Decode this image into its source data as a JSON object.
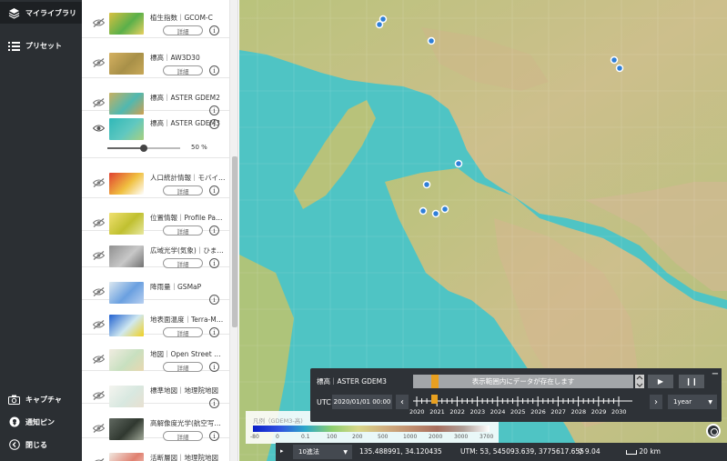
{
  "nav": {
    "library": {
      "label": "マイライブラリ",
      "icon": "layers-icon"
    },
    "preset": {
      "label": "プリセット",
      "icon": "list-icon"
    },
    "capture": {
      "label": "キャプチャ",
      "icon": "camera-icon"
    },
    "notify_pin": {
      "label": "通知ピン",
      "icon": "pin-icon"
    },
    "close": {
      "label": "閉じる",
      "icon": "chevron-left-icon"
    }
  },
  "layers": [
    {
      "name": "植生指数｜GCOM-C",
      "details": "詳細",
      "visible": false
    },
    {
      "name": "標高｜AW3D30",
      "details": "詳細",
      "visible": false
    },
    {
      "name": "標高｜ASTER GDEM2",
      "details": "",
      "visible": false
    },
    {
      "name": "標高｜ASTER GDEM3",
      "details": "",
      "visible": true,
      "opacity_label": "50 %",
      "opacity": 0.5
    },
    {
      "name": "人口統計情報｜モバイ…",
      "details": "詳細",
      "visible": false
    },
    {
      "name": "位置情報｜Profile Pa…",
      "details": "詳細",
      "visible": false
    },
    {
      "name": "広域光学(気象)｜ひま…",
      "details": "詳細",
      "visible": false
    },
    {
      "name": "降雨量｜GSMaP",
      "details": "",
      "visible": false
    },
    {
      "name": "地表面温度｜Terra-M…",
      "details": "詳細",
      "visible": false
    },
    {
      "name": "地図｜Open Street …",
      "details": "詳細",
      "visible": false
    },
    {
      "name": "標準地図｜地理院地図",
      "details": "",
      "visible": false
    },
    {
      "name": "高解像度光学(航空写…",
      "details": "詳細",
      "visible": false
    },
    {
      "name": "活断層図｜地理院地図",
      "details": "",
      "visible": false
    }
  ],
  "time_panel": {
    "layer": "標高｜ASTER GDEM3",
    "message": "表示範囲内にデータが存在します",
    "utc_label": "UTC",
    "date": "2020/01/01 00:00",
    "years": [
      "2020",
      "2021",
      "2022",
      "2023",
      "2024",
      "2025",
      "2026",
      "2027",
      "2028",
      "2029",
      "2030"
    ],
    "step": "1year",
    "play": "▶",
    "pause": "❙❙",
    "minimize": "−"
  },
  "legend": {
    "title": "凡例（GDEM3-高)",
    "labels": [
      "-80",
      "0",
      "0.1",
      "100",
      "200",
      "500",
      "1000",
      "2000",
      "3000",
      "3700"
    ],
    "colors": [
      "#0a1fc8",
      "#3050e0",
      "#2ca8c8",
      "#8ccf6e",
      "#d8d88a",
      "#d0b080",
      "#c09070",
      "#a87060",
      "#b0a098",
      "#ffffff"
    ]
  },
  "status": {
    "format": "10進法",
    "coords": "135.488991, 34.120435",
    "utm": "UTM: 53, 545093.639, 3775617.655",
    "zoom": "9.04",
    "scale": "20 km"
  },
  "colors": {
    "sea": "#4fc4c4",
    "land_low": "#a8c87a",
    "land_mid": "#d4c896",
    "nav_bg": "#2b2f33",
    "panel_bg": "#2e3237",
    "accent": "#e8a020",
    "pin": "#2f7fd8"
  },
  "map_labels": {
    "pins": "pin-icon"
  }
}
